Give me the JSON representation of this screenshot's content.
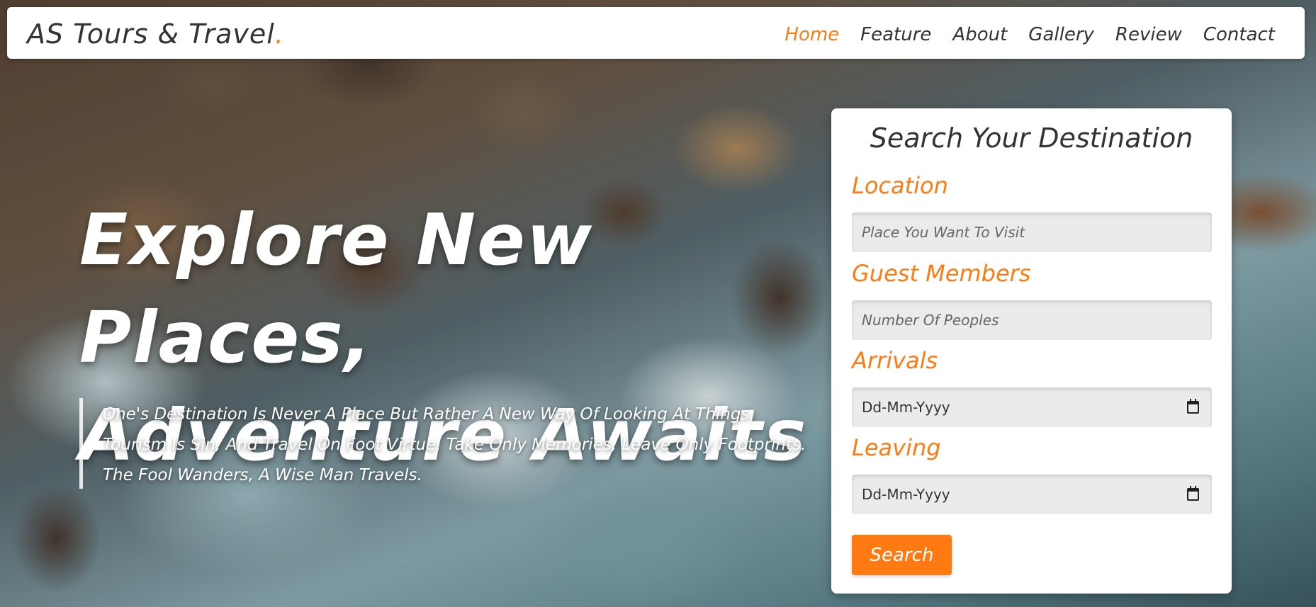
{
  "header": {
    "logo_text": "AS Tours & Travel",
    "logo_dot": ".",
    "nav": [
      {
        "label": "Home"
      },
      {
        "label": "Feature"
      },
      {
        "label": "About"
      },
      {
        "label": "Gallery"
      },
      {
        "label": "Review"
      },
      {
        "label": "Contact"
      }
    ]
  },
  "hero": {
    "title_line1": "Explore New Places,",
    "title_line2": "Adventure Awaits",
    "quote": "One's Destination Is Never A Place But Rather A New Way Of Looking At Things. Tourism Is Sin, And Travel On Foot Virtue. Take Only Memories, Leave Only Footprints. The Fool Wanders, A Wise Man Travels."
  },
  "search": {
    "title": "Search Your Destination",
    "location_label": "Location",
    "location_placeholder": "Place You Want To Visit",
    "guests_label": "Guest Members",
    "guests_placeholder": "Number Of Peoples",
    "arrivals_label": "Arrivals",
    "arrivals_value": "Dd-Mm-Yyyy",
    "leaving_label": "Leaving",
    "leaving_value": "Dd-Mm-Yyyy",
    "button_label": "Search"
  },
  "colors": {
    "accent": "#ff7a12",
    "text": "#333333",
    "field_bg": "#ebebeb"
  },
  "icons": {
    "arrivals_picker": "calendar-icon",
    "leaving_picker": "calendar-icon"
  }
}
